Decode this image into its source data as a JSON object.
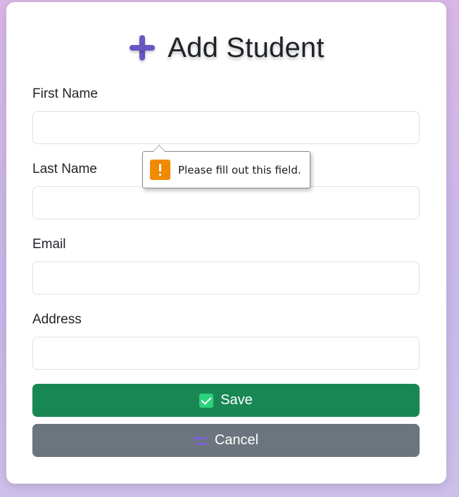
{
  "form": {
    "title": "Add Student",
    "title_icon": "plus-icon",
    "accent_color": "#6a55c4",
    "fields": [
      {
        "label": "First Name",
        "value": "",
        "placeholder": ""
      },
      {
        "label": "Last Name",
        "value": "",
        "placeholder": ""
      },
      {
        "label": "Email",
        "value": "",
        "placeholder": ""
      },
      {
        "label": "Address",
        "value": "",
        "placeholder": ""
      }
    ],
    "save_label": "Save",
    "save_icon": "check-icon",
    "save_color": "#198754",
    "cancel_label": "Cancel",
    "cancel_icon": "back-arrow-icon",
    "cancel_color": "#6c757d"
  },
  "validation": {
    "message": "Please fill out this field.",
    "icon": "warning-icon",
    "icon_color": "#f08a00"
  }
}
